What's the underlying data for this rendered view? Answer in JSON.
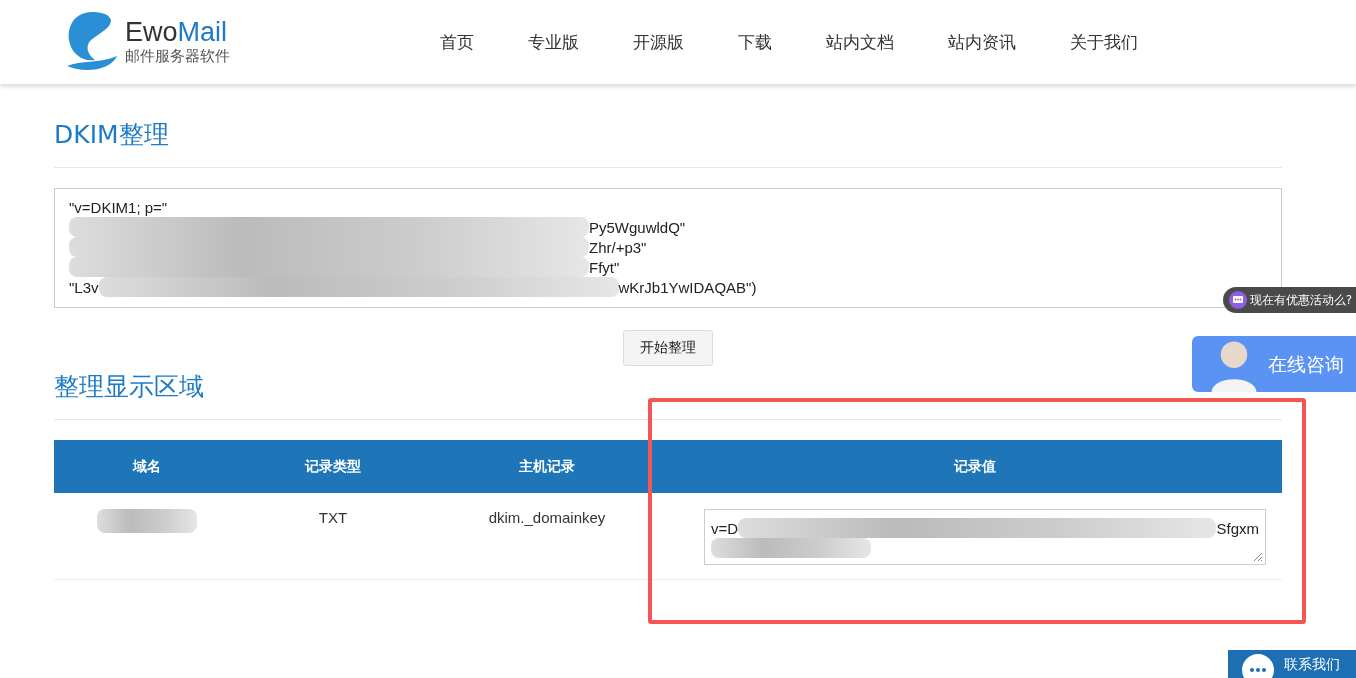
{
  "header": {
    "logo": {
      "name": "Ewo",
      "name_accent": "Mail",
      "tagline": "邮件服务器软件"
    },
    "nav": [
      {
        "label": "首页"
      },
      {
        "label": "专业版"
      },
      {
        "label": "开源版"
      },
      {
        "label": "下载"
      },
      {
        "label": "站内文档"
      },
      {
        "label": "站内资讯"
      },
      {
        "label": "关于我们"
      }
    ]
  },
  "dkim_section": {
    "title": "DKIM整理",
    "input_lines": [
      {
        "start": "\"v=DKIM1; p=\"",
        "redacted": false
      },
      {
        "redacted": true,
        "end": "Py5WguwldQ\""
      },
      {
        "redacted": true,
        "end": "Zhr/+p3\""
      },
      {
        "redacted": true,
        "end": "Ffyt\""
      },
      {
        "start": "\"L3v",
        "redacted": true,
        "end": "wKrJb1YwIDAQAB\")"
      }
    ],
    "button": "开始整理"
  },
  "result_section": {
    "title": "整理显示区域",
    "table": {
      "columns": [
        "域名",
        "记录类型",
        "主机记录",
        "记录值"
      ],
      "rows": [
        {
          "domain_redacted": true,
          "type": "TXT",
          "host": "dkim._domainkey",
          "value_start": "v=D",
          "value_redacted": true,
          "value_end": "Sfgxm"
        }
      ]
    },
    "highlight": true
  },
  "chat_widgets": {
    "bubble": "现在有优惠活动么?",
    "consult": "在线咨询",
    "contact": "联系我们"
  }
}
